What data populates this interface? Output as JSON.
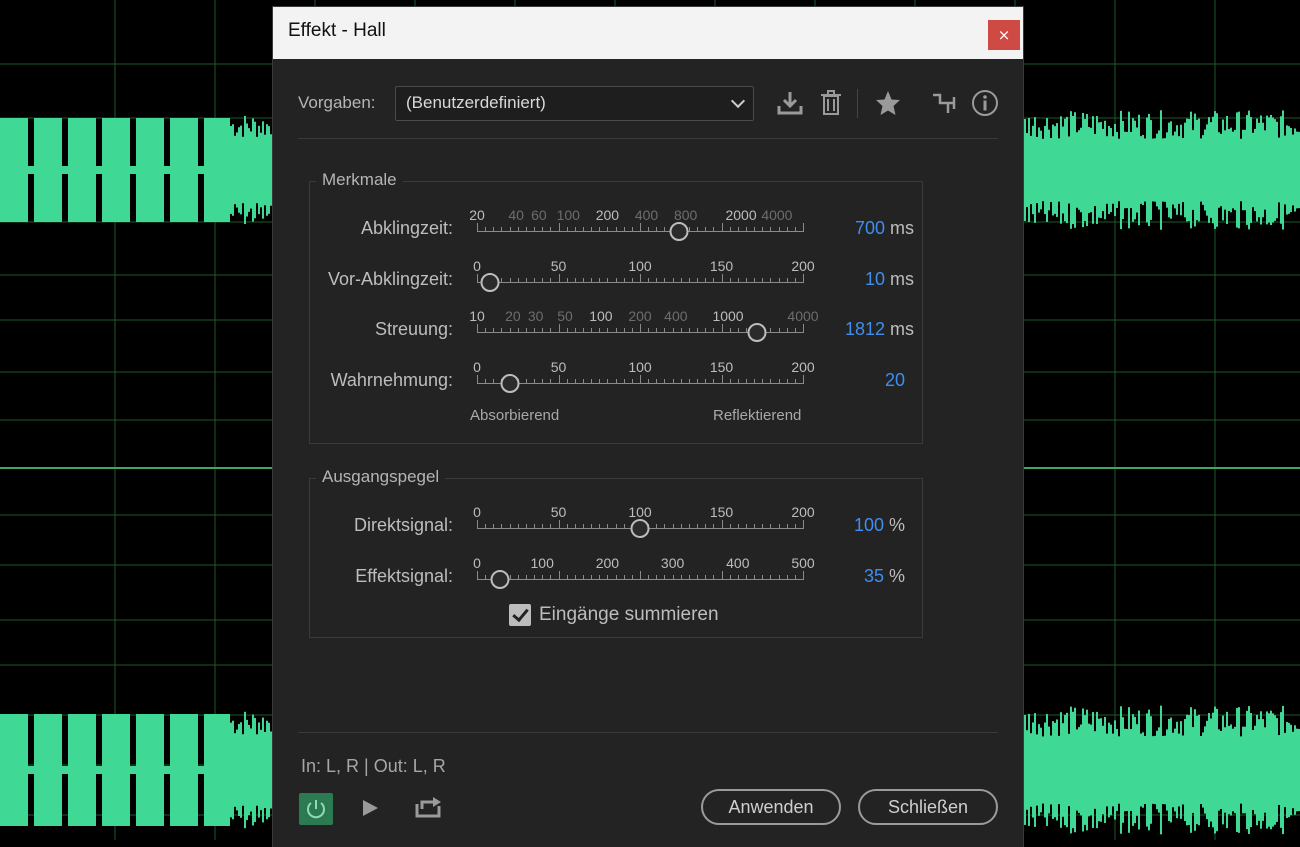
{
  "dialog": {
    "title": "Effekt - Hall",
    "close_icon": "×"
  },
  "presets": {
    "label": "Vorgaben:",
    "value": "(Benutzerdefiniert)"
  },
  "toolbar_icons": [
    "save-preset-icon",
    "trash-icon",
    "star-icon",
    "routing-icon",
    "info-icon"
  ],
  "characteristics": {
    "title": "Merkmale",
    "decay": {
      "label": "Abklingzeit:",
      "ticks": [
        "20",
        "40",
        "60",
        "100",
        "200",
        "400",
        "800",
        "2000",
        "4000"
      ],
      "value": "700",
      "unit": "ms",
      "fraction": 0.62
    },
    "predecay": {
      "label": "Vor-Abklingzeit:",
      "ticks": [
        "0",
        "50",
        "100",
        "150",
        "200"
      ],
      "value": "10",
      "unit": "ms",
      "fraction": 0.04
    },
    "diffusion": {
      "label": "Streuung:",
      "ticks": [
        "10",
        "20",
        "30",
        "50",
        "100",
        "200",
        "400",
        "1000",
        "4000"
      ],
      "value": "1812",
      "unit": "ms",
      "fraction": 0.86
    },
    "perception": {
      "label": "Wahrnehmung:",
      "ticks": [
        "0",
        "50",
        "100",
        "150",
        "200"
      ],
      "value": "20",
      "unit": "",
      "fraction": 0.1,
      "left_label": "Absorbierend",
      "right_label": "Reflektierend"
    }
  },
  "output_levels": {
    "title": "Ausgangspegel",
    "dry": {
      "label": "Direktsignal:",
      "ticks": [
        "0",
        "50",
        "100",
        "150",
        "200"
      ],
      "value": "100",
      "unit": "%",
      "fraction": 0.5
    },
    "wet": {
      "label": "Effektsignal:",
      "ticks": [
        "0",
        "100",
        "200",
        "300",
        "400",
        "500"
      ],
      "value": "35",
      "unit": "%",
      "fraction": 0.07
    },
    "sum_inputs": {
      "label": "Eingänge summieren",
      "checked": true
    }
  },
  "footer": {
    "io": "In: L, R | Out: L, R",
    "apply": "Anwenden",
    "close": "Schließen"
  },
  "colors": {
    "waveform": "#3fd894",
    "accent_value": "#3e8ef0",
    "power_on": "#2c7a52",
    "close_button": "#d04a44"
  }
}
